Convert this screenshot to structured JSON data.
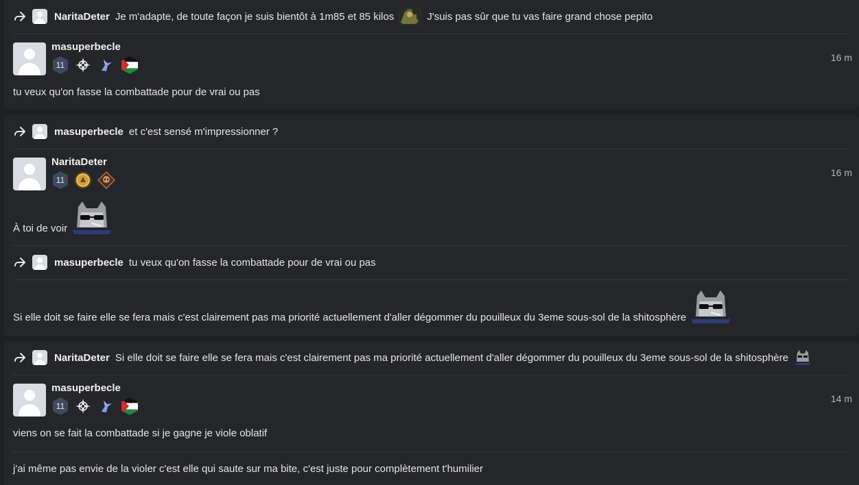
{
  "cards": [
    {
      "quote": {
        "user": "NaritaDeter",
        "text": "Je m'adapte, de toute façon je suis bientôt à 1m85 et 85 kilos",
        "text_after_emoji": "J'suis pas sûr que tu vas faire grand chose pepito"
      },
      "post": {
        "username": "masuperbecle",
        "level": "11",
        "time": "16 m",
        "lines": [
          "tu veux qu'on fasse la combattade pour de vrai ou pas"
        ]
      }
    },
    {
      "quote": {
        "user": "masuperbecle",
        "text": "et c'est sensé m'impressionner ?"
      },
      "post": {
        "username": "NaritaDeter",
        "level": "11",
        "time": "16 m",
        "lines": [
          "À toi de voir"
        ]
      },
      "quote2": {
        "user": "masuperbecle",
        "text": "tu veux qu'on fasse la combattade pour de vrai ou pas"
      },
      "reply_text": "Si elle doit se faire elle se fera mais c'est clairement pas ma priorité actuellement d'aller dégommer du pouilleux du 3eme sous-sol de la shitosphère"
    },
    {
      "quote": {
        "user": "NaritaDeter",
        "text": "Si elle doit se faire elle se fera mais c'est clairement pas ma priorité actuellement d'aller dégommer du pouilleux du 3eme sous-sol de la shitosphère"
      },
      "post": {
        "username": "masuperbecle",
        "level": "11",
        "time": "14 m",
        "lines": [
          "viens on se fait la combattade si je gagne je viole oblatif",
          "j'ai même pas envie de la violer c'est elle qui saute sur ma bite, c'est juste pour complètement t'humilier"
        ]
      }
    }
  ],
  "icons": {
    "reply": "reply-arrow-icon",
    "level_badge": "hexagon-level-icon",
    "compass": "compass-star-icon",
    "bird": "hummingbird-icon",
    "flag": "palestine-flag-icon",
    "gold_medal": "gold-medal-icon",
    "bronze_medal": "bronze-skull-medal-icon",
    "cat": "cat-sunglasses-emoji",
    "warrior": "green-warrior-emoji"
  },
  "colors": {
    "background": "#1f2023",
    "card": "#25262a",
    "divider": "#34363b",
    "text": "#e6e6e6",
    "muted": "#b5b7bb",
    "level_badge": "#3f4a5e"
  }
}
